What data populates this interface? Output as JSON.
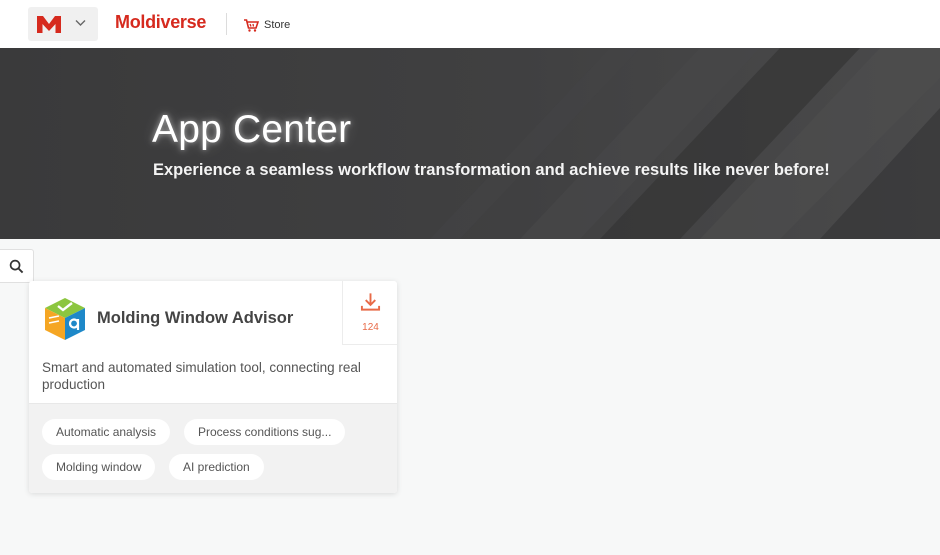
{
  "header": {
    "brand": "Moldiverse",
    "store_label": "Store",
    "brand_color": "#d62a1e"
  },
  "hero": {
    "title": "App Center",
    "subtitle": "Experience a seamless workflow transformation and achieve results like never before!"
  },
  "icons": {
    "search": "search-icon",
    "download": "download-icon",
    "store": "cart-icon",
    "app_switcher": "chevron-down-icon"
  },
  "card": {
    "title": "Molding Window Advisor",
    "description": "Smart and automated simulation tool, connecting real production",
    "download_count": "124",
    "tags": [
      "Automatic analysis",
      "Process conditions sug...",
      "Molding window",
      "AI prediction"
    ],
    "accent_color": "#e86a47"
  }
}
